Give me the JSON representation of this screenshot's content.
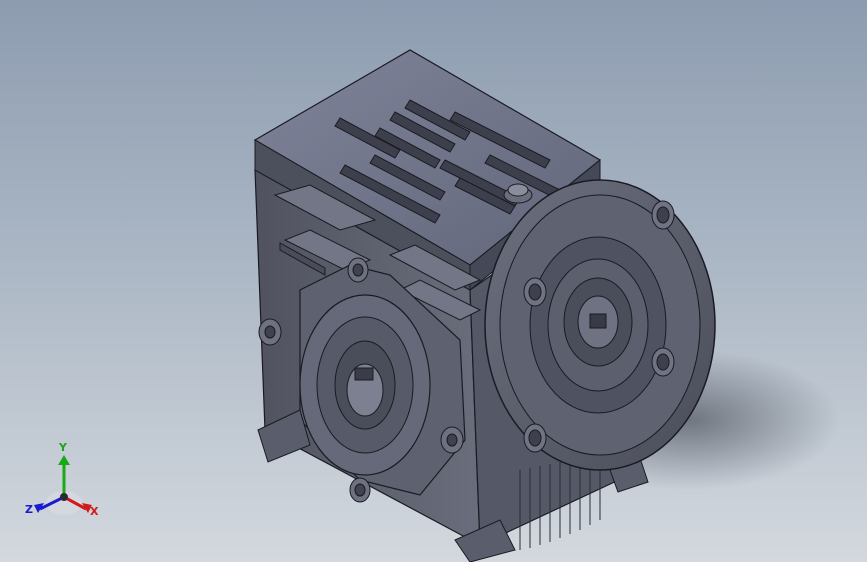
{
  "triad": {
    "x_label": "X",
    "y_label": "Y",
    "z_label": "Z",
    "x_color": "#d11a1a",
    "y_color": "#18a818",
    "z_color": "#1a1ad1"
  },
  "colors": {
    "background_top": "#8d9cb0",
    "background_bottom": "#d3d8de",
    "body_shade_light": "#7a7d8c",
    "body_shade_mid": "#5b5e6c",
    "body_shade_dark": "#3c3f4a",
    "edge": "#1a1b22"
  }
}
